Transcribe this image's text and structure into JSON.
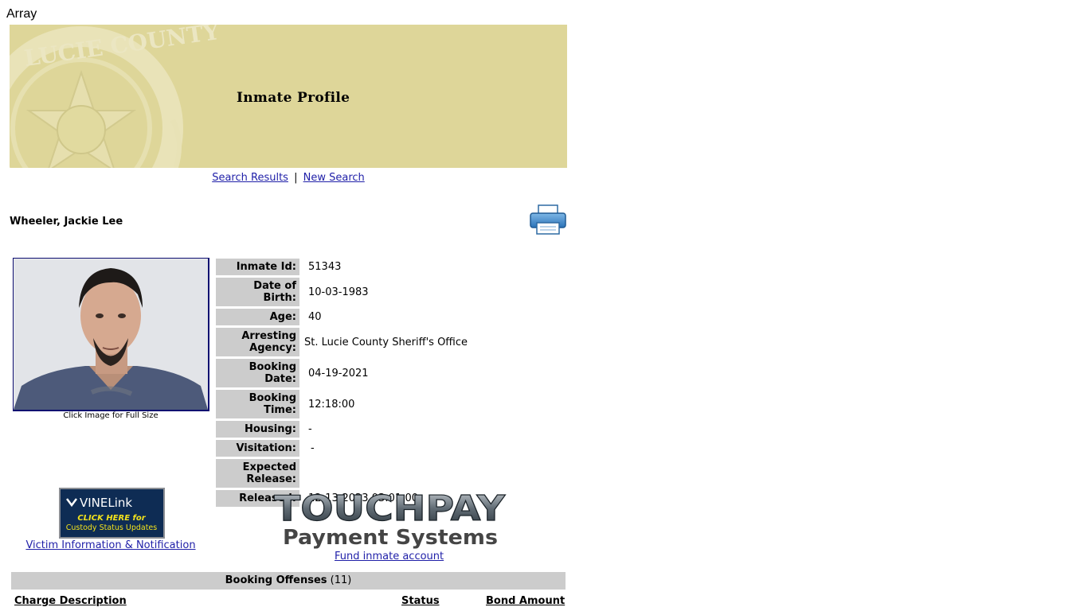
{
  "debug_text": "Array",
  "banner": {
    "title": "Inmate Profile"
  },
  "nav": {
    "search_results": "Search Results",
    "separator": "|",
    "new_search": "New Search"
  },
  "inmate": {
    "name": "Wheeler, Jackie Lee",
    "photo_caption": "Click Image for Full Size",
    "fields": [
      {
        "label": "Inmate Id:",
        "value": "51343"
      },
      {
        "label": "Date of Birth:",
        "value": "10-03-1983"
      },
      {
        "label": "Age:",
        "value": "40"
      },
      {
        "label": "Arresting Agency:",
        "value": "St. Lucie County Sheriff's Office"
      },
      {
        "label": "Booking Date:",
        "value": "04-19-2021"
      },
      {
        "label": "Booking Time:",
        "value": "12:18:00"
      },
      {
        "label": "Housing:",
        "value": "-"
      },
      {
        "label": "Visitation:",
        "value": "-"
      },
      {
        "label": "Expected Release:",
        "value": ""
      },
      {
        "label": "Released:",
        "value": "12-13-2023 03:01:00"
      }
    ]
  },
  "vine": {
    "logo_text": "VINELink",
    "cta_line1": "CLICK HERE for",
    "cta_line2": "Custody Status Updates",
    "link": "Victim Information & Notification"
  },
  "touchpay": {
    "logo_text": "TOUCHPAY",
    "subtitle": "Payment Systems",
    "link": "Fund inmate account"
  },
  "offenses": {
    "title": "Booking Offenses",
    "count": "(11)",
    "columns": [
      "Charge Description",
      "Status",
      "Bond Amount"
    ]
  },
  "colors": {
    "banner_bg": "#ded699",
    "label_bg": "#cccccc",
    "link": "#1f1fa8"
  }
}
